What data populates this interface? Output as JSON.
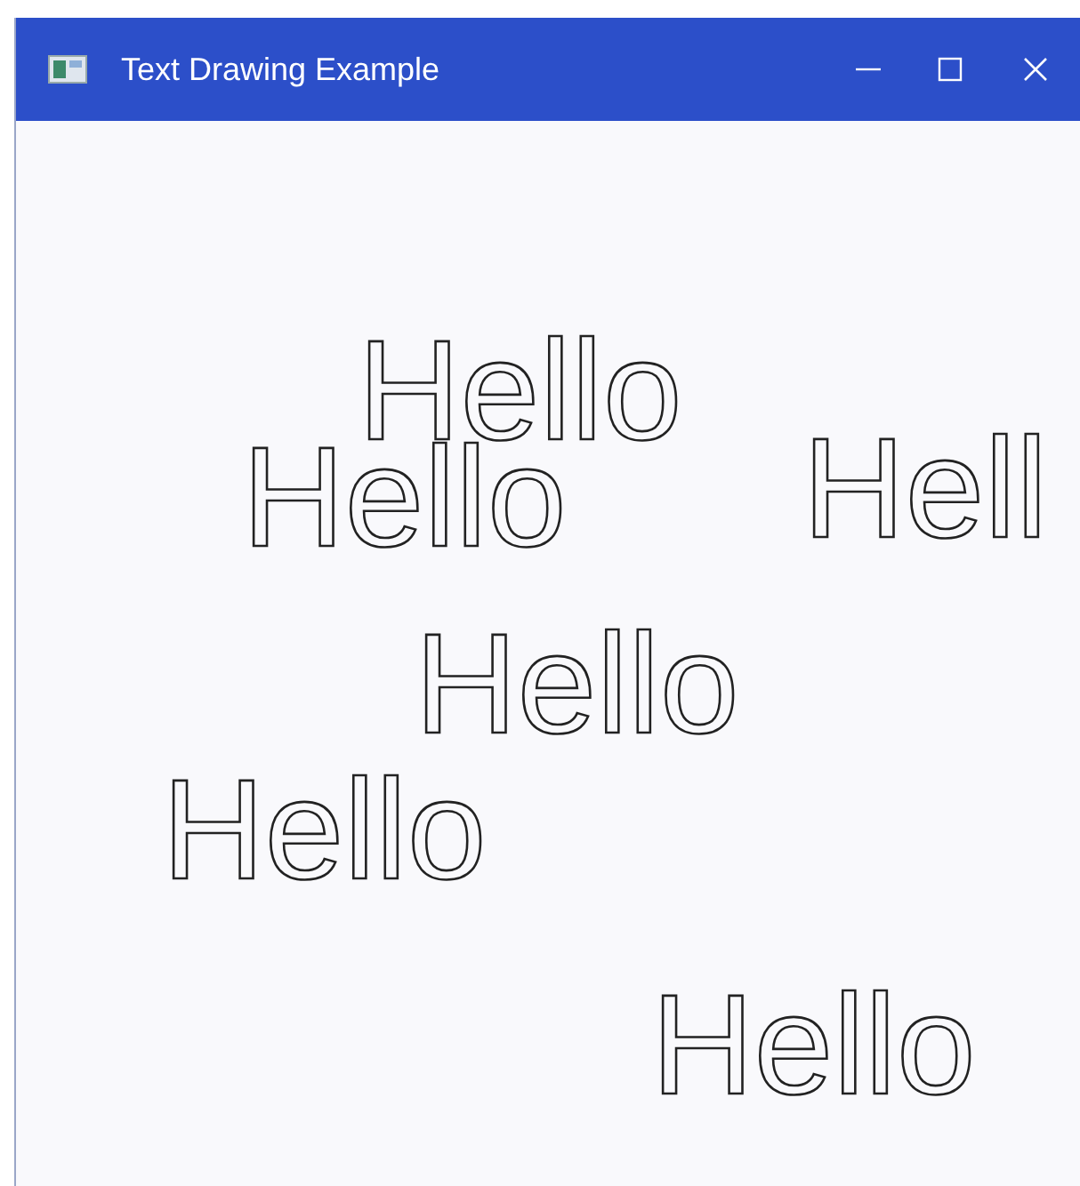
{
  "window": {
    "title": "Text Drawing Example"
  },
  "canvas": {
    "texts": [
      {
        "text": "Hello"
      },
      {
        "text": "Hello"
      },
      {
        "text": "Hell"
      },
      {
        "text": "Hello"
      },
      {
        "text": "Hello"
      },
      {
        "text": "Hello"
      }
    ]
  }
}
